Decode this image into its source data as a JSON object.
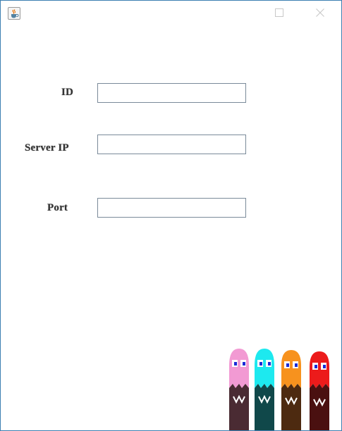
{
  "window": {
    "icon": "java-coffee-icon",
    "controls": {
      "maximize_icon": "maximize-icon",
      "close_icon": "close-icon"
    }
  },
  "form": {
    "id_label": "ID",
    "id_value": "",
    "server_ip_label": "Server IP",
    "server_ip_value": "",
    "port_label": "Port",
    "port_value": ""
  },
  "decoration": {
    "ghosts": [
      {
        "name": "pinky-ghost",
        "color": "#f29ad3"
      },
      {
        "name": "inky-ghost",
        "color": "#1de9ef"
      },
      {
        "name": "clyde-ghost",
        "color": "#f7921e"
      },
      {
        "name": "blinky-ghost",
        "color": "#ec1b1b"
      }
    ]
  }
}
